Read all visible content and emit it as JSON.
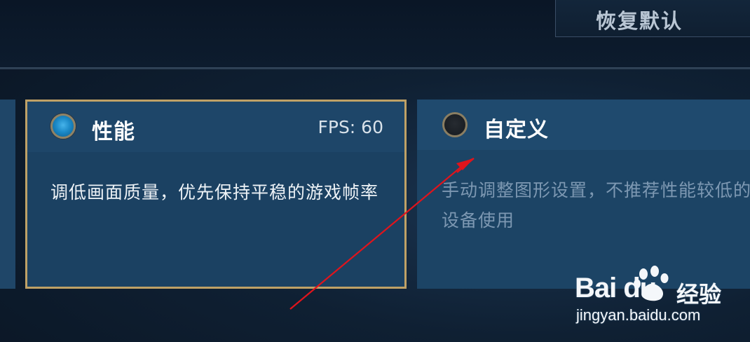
{
  "toolbar": {
    "reset_label": "恢复默认"
  },
  "cards": {
    "performance": {
      "title": "性能",
      "fps_label": "FPS: 60",
      "description": "调低画面质量，优先保持平稳的游戏帧率",
      "selected": true
    },
    "custom": {
      "title": "自定义",
      "description": "手动调整图形设置，不推荐性能较低的设备使用",
      "selected": false
    }
  },
  "watermark": {
    "brand": "Bai du",
    "brand_cn": "经验",
    "url": "jingyan.baidu.com"
  },
  "colors": {
    "selected_border": "#bfa166",
    "card_bg": "#1c4465",
    "radio_on": "#1c8ac8",
    "annotation_arrow": "#e0141c"
  }
}
